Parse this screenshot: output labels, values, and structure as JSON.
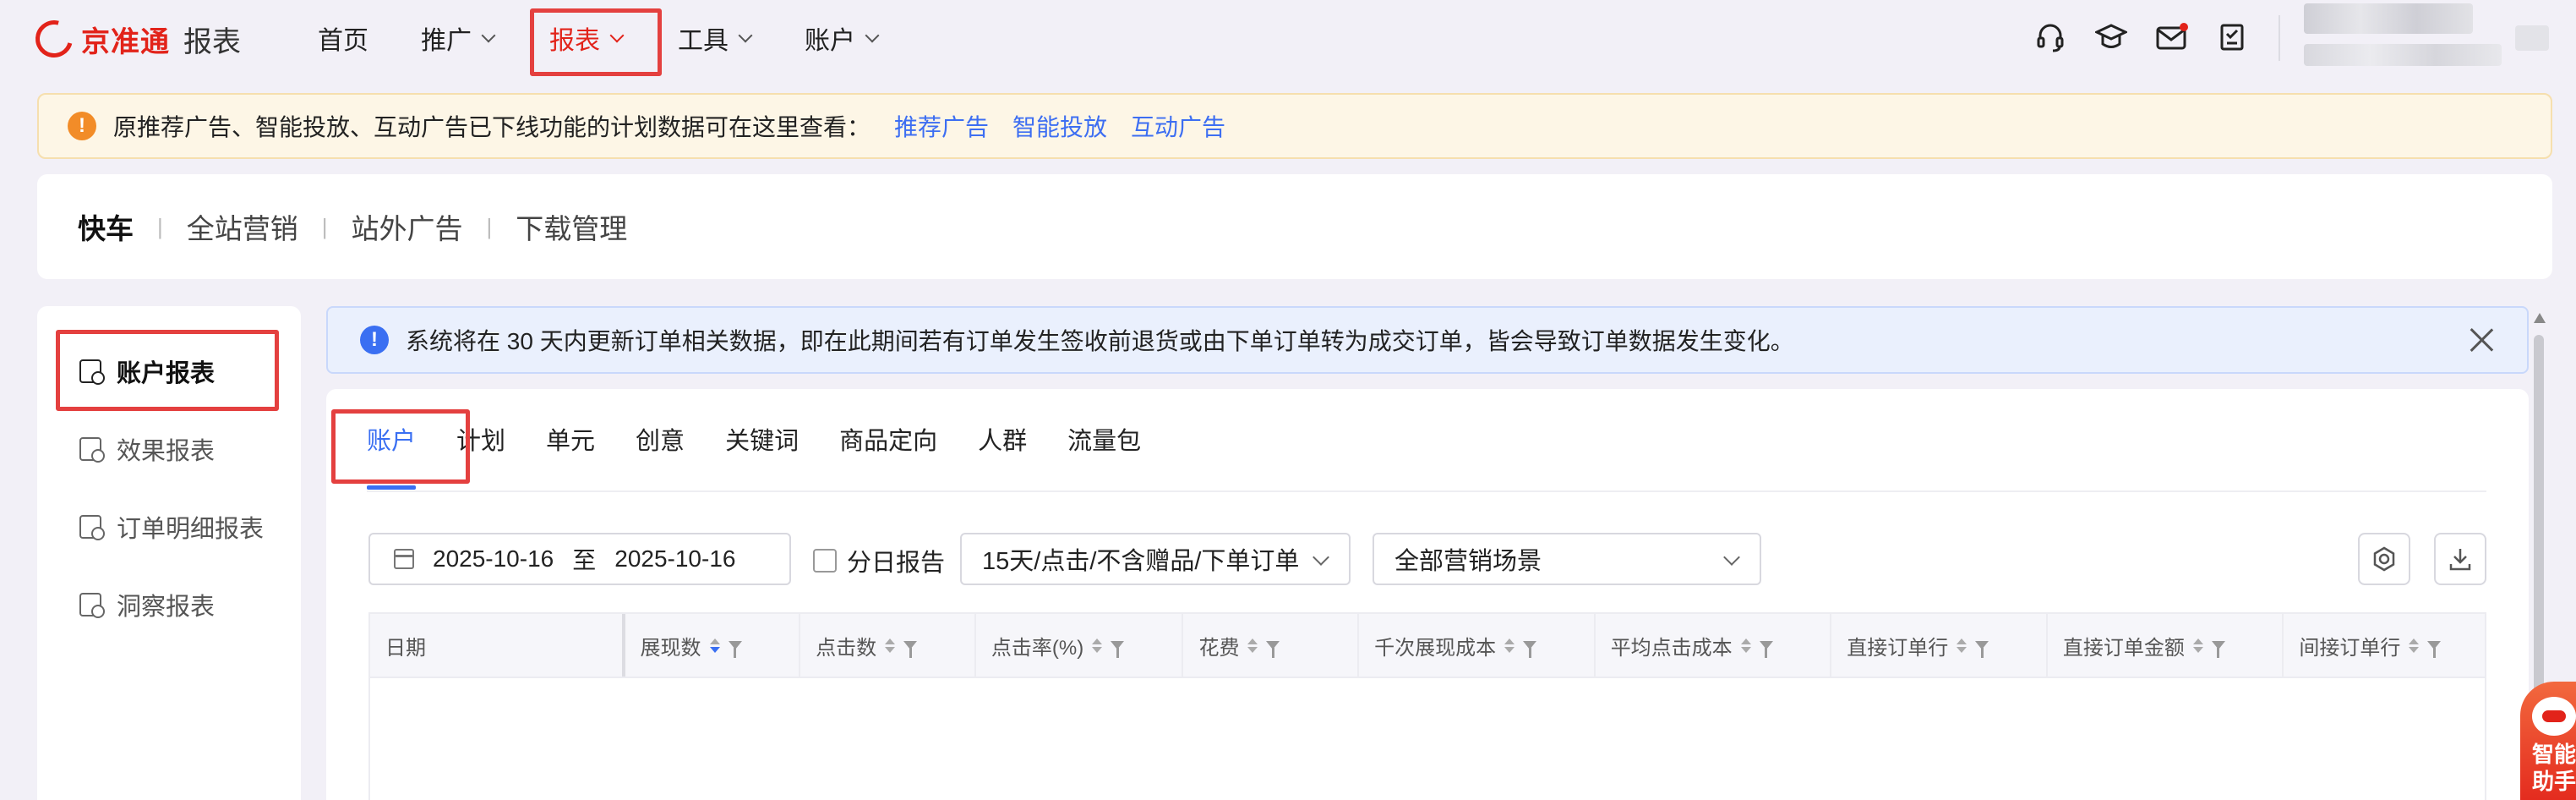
{
  "header": {
    "logo_brand": "京准通",
    "logo_sub": "报表",
    "nav": [
      {
        "label": "首页"
      },
      {
        "label": "推广"
      },
      {
        "label": "报表"
      },
      {
        "label": "工具"
      },
      {
        "label": "账户"
      }
    ],
    "icons": [
      "headset-icon",
      "graduation-cap-icon",
      "mail-icon",
      "checklist-icon"
    ],
    "accent": "#e2231a"
  },
  "notice": {
    "text": "原推荐广告、智能投放、互动广告已下线功能的计划数据可在这里查看：",
    "links": [
      "推荐广告",
      "智能投放",
      "互动广告"
    ]
  },
  "product_tabs": [
    "快车",
    "全站营销",
    "站外广告",
    "下载管理"
  ],
  "sidebar": {
    "items": [
      {
        "label": "账户报表"
      },
      {
        "label": "效果报表"
      },
      {
        "label": "订单明细报表"
      },
      {
        "label": "洞察报表"
      }
    ]
  },
  "info_banner": {
    "text": "系统将在 30 天内更新订单相关数据，即在此期间若有订单发生签收前退货或由下单订单转为成交订单，皆会导致订单数据发生变化。"
  },
  "report_tabs": [
    "账户",
    "计划",
    "单元",
    "创意",
    "关键词",
    "商品定向",
    "人群",
    "流量包"
  ],
  "filters": {
    "start_date": "2025-10-16",
    "range_sep": "至",
    "end_date": "2025-10-16",
    "daily_report_label": "分日报告",
    "attribution_select": "15天/点击/不含赠品/下单订单",
    "scene_select": "全部营销场景"
  },
  "table": {
    "columns": [
      "日期",
      "展现数",
      "点击数",
      "点击率(%)",
      "花费",
      "千次展现成本",
      "平均点击成本",
      "直接订单行",
      "直接订单金额",
      "间接订单行"
    ]
  },
  "assistant": {
    "label": "智能助手"
  },
  "colors": {
    "link_blue": "#3d6ef2",
    "warning_orange": "#f28c28",
    "info_blue": "#3a6ff2",
    "highlight_red": "#e4403f"
  }
}
